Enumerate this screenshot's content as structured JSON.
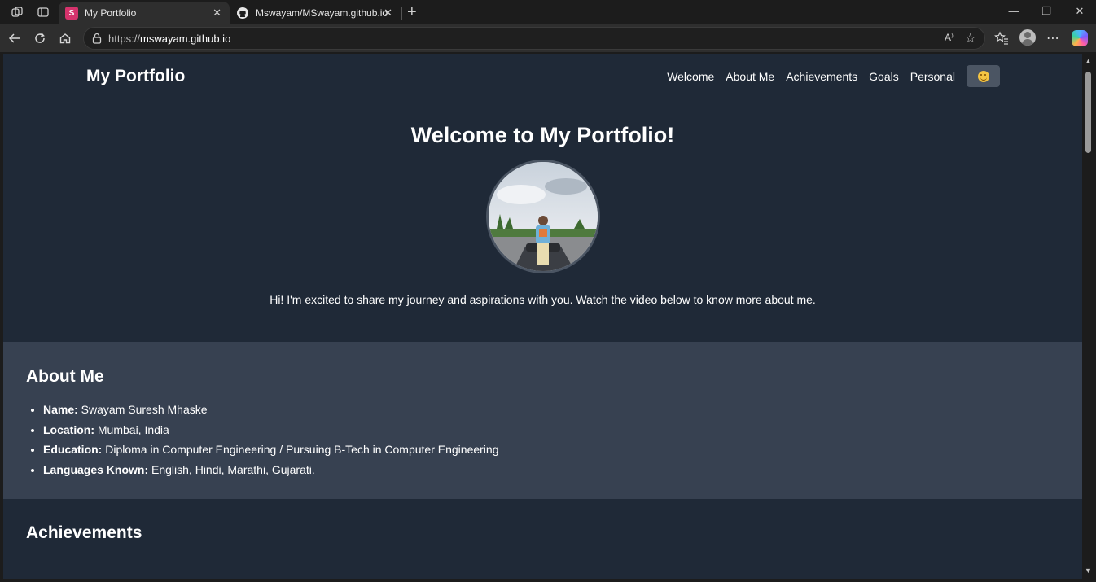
{
  "browser": {
    "tabs": [
      {
        "title": "My Portfolio",
        "active": true,
        "favicon": "portfolio-favicon"
      },
      {
        "title": "Mswayam/MSwayam.github.io",
        "active": false,
        "favicon": "github-icon"
      }
    ],
    "url_scheme": "https://",
    "url_host": "mswayam.github.io",
    "read_aloud_label": "A⁾"
  },
  "site": {
    "title": "My Portfolio",
    "nav": [
      "Welcome",
      "About Me",
      "Achievements",
      "Goals",
      "Personal"
    ],
    "theme_toggle_icon": "emoji-face-icon"
  },
  "hero": {
    "heading": "Welcome to My Portfolio!",
    "intro": "Hi! I'm excited to share my journey and aspirations with you. Watch the video below to know more about me."
  },
  "about": {
    "heading": "About Me",
    "items": [
      {
        "label": "Name:",
        "value": " Swayam Suresh Mhaske"
      },
      {
        "label": "Location:",
        "value": " Mumbai, India"
      },
      {
        "label": "Education:",
        "value": " Diploma in Computer Engineering / Pursuing B-Tech in Computer Engineering"
      },
      {
        "label": "Languages Known:",
        "value": " English, Hindi, Marathi, Gujarati."
      }
    ]
  },
  "achievements": {
    "heading": "Achievements"
  },
  "colors": {
    "page_bg": "#1f2937",
    "section_bg": "#374151",
    "button_bg": "#4b5563"
  }
}
